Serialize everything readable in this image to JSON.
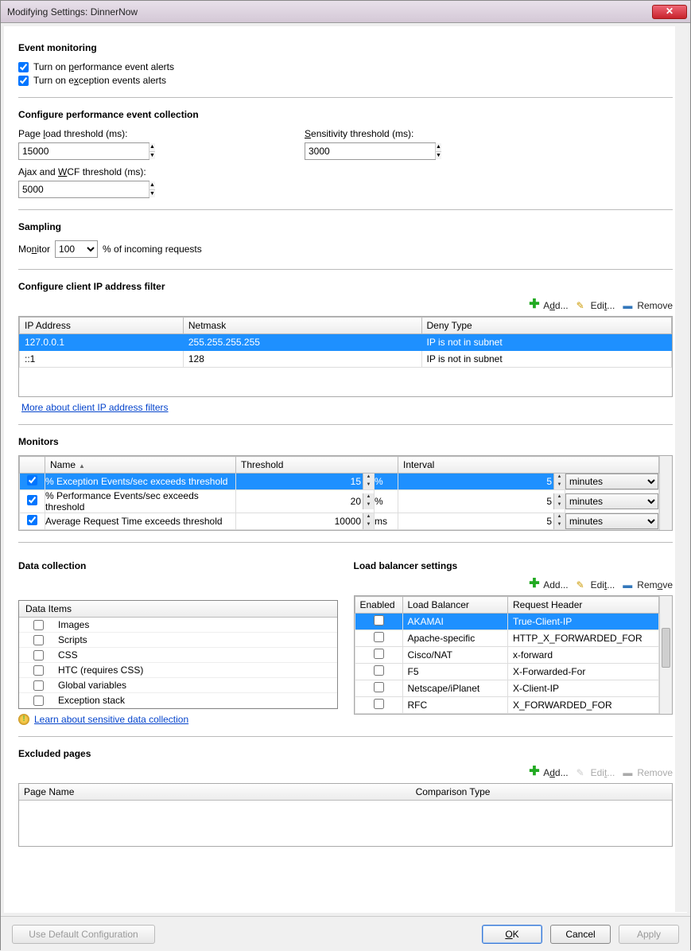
{
  "window": {
    "title": "Modifying Settings: DinnerNow"
  },
  "event_monitoring": {
    "title": "Event monitoring",
    "perf_alerts_label": "Turn on performance event alerts",
    "perf_alerts_checked": true,
    "exc_alerts_label": "Turn on exception events alerts",
    "exc_alerts_checked": true
  },
  "perf_collection": {
    "title": "Configure performance event collection",
    "page_load_label": "Page load threshold (ms):",
    "page_load_value": "15000",
    "sensitivity_label": "Sensitivity threshold (ms):",
    "sensitivity_value": "3000",
    "ajax_label": "Ajax and WCF threshold (ms):",
    "ajax_value": "5000"
  },
  "sampling": {
    "title": "Sampling",
    "monitor_label": "Monitor",
    "percent_value": "100",
    "suffix": "% of incoming requests"
  },
  "ip_filter": {
    "title": "Configure client IP address filter",
    "add": "Add...",
    "edit": "Edit...",
    "remove": "Remove",
    "col_ip": "IP Address",
    "col_mask": "Netmask",
    "col_deny": "Deny Type",
    "rows": [
      {
        "ip": "127.0.0.1",
        "mask": "255.255.255.255",
        "deny": "IP is not in subnet",
        "selected": true
      },
      {
        "ip": "::1",
        "mask": "128",
        "deny": "IP is not in subnet",
        "selected": false
      }
    ],
    "more_link": "More about client IP address filters"
  },
  "monitors": {
    "title": "Monitors",
    "col_blank": "",
    "col_name": "Name",
    "col_threshold": "Threshold",
    "col_interval": "Interval",
    "rows": [
      {
        "checked": true,
        "name": "% Exception Events/sec exceeds threshold",
        "threshold": "15",
        "unit": "%",
        "interval": "5",
        "interval_unit": "minutes",
        "selected": true
      },
      {
        "checked": true,
        "name": "% Performance Events/sec exceeds threshold",
        "threshold": "20",
        "unit": "%",
        "interval": "5",
        "interval_unit": "minutes",
        "selected": false
      },
      {
        "checked": true,
        "name": "Average Request Time exceeds threshold",
        "threshold": "10000",
        "unit": "ms",
        "interval": "5",
        "interval_unit": "minutes",
        "selected": false
      }
    ]
  },
  "data_collection": {
    "title": "Data collection",
    "header": "Data Items",
    "items": [
      {
        "label": "Images",
        "checked": false
      },
      {
        "label": "Scripts",
        "checked": false
      },
      {
        "label": "CSS",
        "checked": false
      },
      {
        "label": "HTC (requires CSS)",
        "checked": false
      },
      {
        "label": "Global variables",
        "checked": false
      },
      {
        "label": "Exception stack",
        "checked": false
      }
    ],
    "learn_link": "Learn about sensitive data collection"
  },
  "load_balancer": {
    "title": "Load balancer settings",
    "add": "Add...",
    "edit": "Edit...",
    "remove": "Remove",
    "col_enabled": "Enabled",
    "col_lb": "Load Balancer",
    "col_header": "Request Header",
    "rows": [
      {
        "enabled": false,
        "lb": "AKAMAI",
        "header": "True-Client-IP",
        "selected": true
      },
      {
        "enabled": false,
        "lb": "Apache-specific",
        "header": "HTTP_X_FORWARDED_FOR",
        "selected": false
      },
      {
        "enabled": false,
        "lb": "Cisco/NAT",
        "header": "x-forward",
        "selected": false
      },
      {
        "enabled": false,
        "lb": "F5",
        "header": "X-Forwarded-For",
        "selected": false
      },
      {
        "enabled": false,
        "lb": "Netscape/iPlanet",
        "header": "X-Client-IP",
        "selected": false
      },
      {
        "enabled": false,
        "lb": "RFC",
        "header": "X_FORWARDED_FOR",
        "selected": false
      }
    ]
  },
  "excluded": {
    "title": "Excluded pages",
    "add": "Add...",
    "edit": "Edit...",
    "remove": "Remove",
    "col_page": "Page Name",
    "col_comp": "Comparison Type"
  },
  "footer": {
    "use_default": "Use Default Configuration",
    "ok": "OK",
    "cancel": "Cancel",
    "apply": "Apply"
  }
}
